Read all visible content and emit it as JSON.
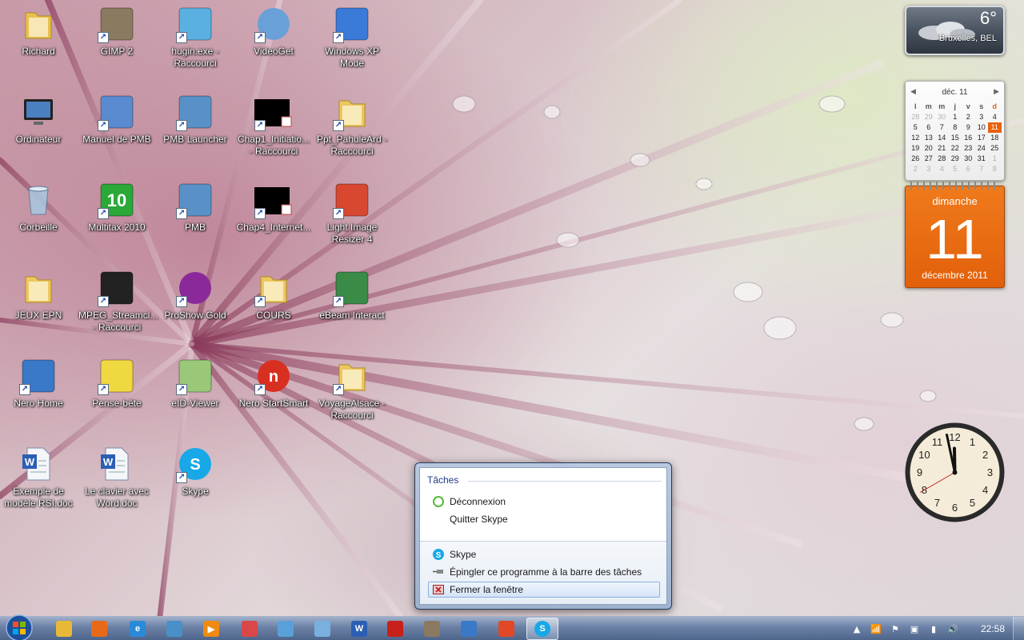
{
  "desktop": {
    "icons": [
      {
        "label": "Richard",
        "icon": "user-folder-icon",
        "shortcut": false
      },
      {
        "label": "GIMP 2",
        "icon": "gimp-icon",
        "shortcut": true
      },
      {
        "label": "hugin.exe - Raccourci",
        "icon": "hugin-icon",
        "shortcut": true
      },
      {
        "label": "VideoGet",
        "icon": "videoget-icon",
        "shortcut": true
      },
      {
        "label": "Windows XP Mode",
        "icon": "windows-xp-mode-icon",
        "shortcut": true
      },
      {
        "label": "Ordinateur",
        "icon": "computer-icon",
        "shortcut": false
      },
      {
        "label": "Manuel de PMB",
        "icon": "manual-icon",
        "shortcut": true
      },
      {
        "label": "PMB Launcher",
        "icon": "pmb-launcher-icon",
        "shortcut": true
      },
      {
        "label": "Chap1_Initiatio... - Raccourci",
        "icon": "document-shortcut-icon",
        "shortcut": true
      },
      {
        "label": "Ppt_PahuleArd - Raccourci",
        "icon": "folder-icon",
        "shortcut": true
      },
      {
        "label": "Corbeille",
        "icon": "recycle-bin-icon",
        "shortcut": false
      },
      {
        "label": "Multitax 2010",
        "icon": "multitax-icon",
        "shortcut": true
      },
      {
        "label": "PMB",
        "icon": "pmb-icon",
        "shortcut": true
      },
      {
        "label": "Chap4_Internet...",
        "icon": "document-shortcut-icon",
        "shortcut": true
      },
      {
        "label": "Light Image Resizer 4",
        "icon": "image-resizer-icon",
        "shortcut": true
      },
      {
        "label": "JEUX EPN",
        "icon": "folder-icon",
        "shortcut": false
      },
      {
        "label": "MPEG_Streamcl... - Raccourci",
        "icon": "clapperboard-icon",
        "shortcut": true
      },
      {
        "label": "ProShow Gold",
        "icon": "proshow-icon",
        "shortcut": true
      },
      {
        "label": "COURS",
        "icon": "folder-icon",
        "shortcut": true
      },
      {
        "label": "eBeam Interact",
        "icon": "ebeam-icon",
        "shortcut": true
      },
      {
        "label": "Nero Home",
        "icon": "nero-home-icon",
        "shortcut": true
      },
      {
        "label": "Pense-bête",
        "icon": "sticky-notes-icon",
        "shortcut": true
      },
      {
        "label": "eID-Viewer",
        "icon": "eid-card-icon",
        "shortcut": true
      },
      {
        "label": "Nero StartSmart",
        "icon": "nero-icon",
        "shortcut": true
      },
      {
        "label": "VoyageAlsace - Raccourci",
        "icon": "folder-icon",
        "shortcut": true
      },
      {
        "label": "Exemple de modèle RSI.doc",
        "icon": "word-doc-icon",
        "shortcut": false
      },
      {
        "label": "Le clavier avec Word.doc",
        "icon": "word-doc-icon",
        "shortcut": false
      },
      {
        "label": "Skype",
        "icon": "skype-icon",
        "shortcut": true
      }
    ]
  },
  "weather_gadget": {
    "temperature": "6°",
    "location": "Bruxelles, BEL"
  },
  "calendar_gadget": {
    "month_label": "déc. 11",
    "weekday_headers": [
      "l",
      "m",
      "m",
      "j",
      "v",
      "s",
      "d"
    ],
    "days": [
      {
        "d": "28",
        "dim": true
      },
      {
        "d": "29",
        "dim": true
      },
      {
        "d": "30",
        "dim": true
      },
      {
        "d": "1"
      },
      {
        "d": "2"
      },
      {
        "d": "3"
      },
      {
        "d": "4"
      },
      {
        "d": "5"
      },
      {
        "d": "6"
      },
      {
        "d": "7"
      },
      {
        "d": "8"
      },
      {
        "d": "9"
      },
      {
        "d": "10"
      },
      {
        "d": "11",
        "today": true
      },
      {
        "d": "12"
      },
      {
        "d": "13"
      },
      {
        "d": "14"
      },
      {
        "d": "15"
      },
      {
        "d": "16"
      },
      {
        "d": "17"
      },
      {
        "d": "18"
      },
      {
        "d": "19"
      },
      {
        "d": "20"
      },
      {
        "d": "21"
      },
      {
        "d": "22"
      },
      {
        "d": "23"
      },
      {
        "d": "24"
      },
      {
        "d": "25"
      },
      {
        "d": "26"
      },
      {
        "d": "27"
      },
      {
        "d": "28"
      },
      {
        "d": "29"
      },
      {
        "d": "30"
      },
      {
        "d": "31"
      },
      {
        "d": "1",
        "dim": true
      },
      {
        "d": "2",
        "dim": true
      },
      {
        "d": "3",
        "dim": true
      },
      {
        "d": "4",
        "dim": true
      },
      {
        "d": "5",
        "dim": true
      },
      {
        "d": "6",
        "dim": true
      },
      {
        "d": "7",
        "dim": true
      },
      {
        "d": "8",
        "dim": true
      }
    ],
    "day_name": "dimanche",
    "day_number": "11",
    "month_year": "décembre 2011",
    "accent_color": "#e8620e"
  },
  "clock_gadget": {
    "time": "11:58"
  },
  "jump_list": {
    "section_title": "Tâches",
    "tasks": [
      {
        "label": "Déconnexion",
        "icon": "skype-status-icon"
      },
      {
        "label": "Quitter Skype",
        "icon": ""
      }
    ],
    "actions": [
      {
        "label": "Skype",
        "icon": "skype-icon"
      },
      {
        "label": "Épingler ce programme à la barre des tâches",
        "icon": "pin-icon"
      },
      {
        "label": "Fermer la fenêtre",
        "icon": "close-window-icon",
        "highlighted": true
      }
    ]
  },
  "taskbar": {
    "pinned": [
      {
        "name": "explorer",
        "icon": "folder-icon",
        "glyph": "",
        "color": "#e8b838"
      },
      {
        "name": "firefox",
        "icon": "firefox-icon",
        "glyph": "",
        "color": "#e86a18"
      },
      {
        "name": "internet-explorer",
        "icon": "internet-explorer-icon",
        "glyph": "e",
        "color": "#2a8ad8"
      },
      {
        "name": "pictures",
        "icon": "photo-viewer-icon",
        "glyph": "",
        "color": "#4a90c8"
      },
      {
        "name": "media-player",
        "icon": "media-player-icon",
        "glyph": "▶",
        "color": "#f08a10"
      },
      {
        "name": "paint",
        "icon": "paint-icon",
        "glyph": "",
        "color": "#d84848"
      },
      {
        "name": "paint-shop",
        "icon": "palette-icon",
        "glyph": "",
        "color": "#5aa0d8"
      },
      {
        "name": "notepad",
        "icon": "notepad-icon",
        "glyph": "",
        "color": "#7ab0e0"
      },
      {
        "name": "word",
        "icon": "word-icon",
        "glyph": "W",
        "color": "#2b5fb4"
      },
      {
        "name": "acrobat",
        "icon": "acrobat-icon",
        "glyph": "",
        "color": "#c8201a"
      },
      {
        "name": "gimp",
        "icon": "gimp-icon",
        "glyph": "",
        "color": "#8a7a60"
      },
      {
        "name": "thunderbird",
        "icon": "thunderbird-icon",
        "glyph": "",
        "color": "#3a78c8"
      },
      {
        "name": "picasa",
        "icon": "picasa-icon",
        "glyph": "",
        "color": "#e04828"
      },
      {
        "name": "skype",
        "icon": "skype-icon",
        "glyph": "S",
        "color": "#18a8e8",
        "active": true
      }
    ],
    "tray": [
      {
        "icon": "show-hidden-icons-icon",
        "glyph": "▲"
      },
      {
        "icon": "wireless-icon",
        "glyph": "📶"
      },
      {
        "icon": "action-center-flag-icon",
        "glyph": "⚑"
      },
      {
        "icon": "usb-device-icon",
        "glyph": "▣"
      },
      {
        "icon": "network-icon",
        "glyph": "▮"
      },
      {
        "icon": "volume-icon",
        "glyph": "🔊"
      }
    ],
    "clock": "22:58"
  }
}
